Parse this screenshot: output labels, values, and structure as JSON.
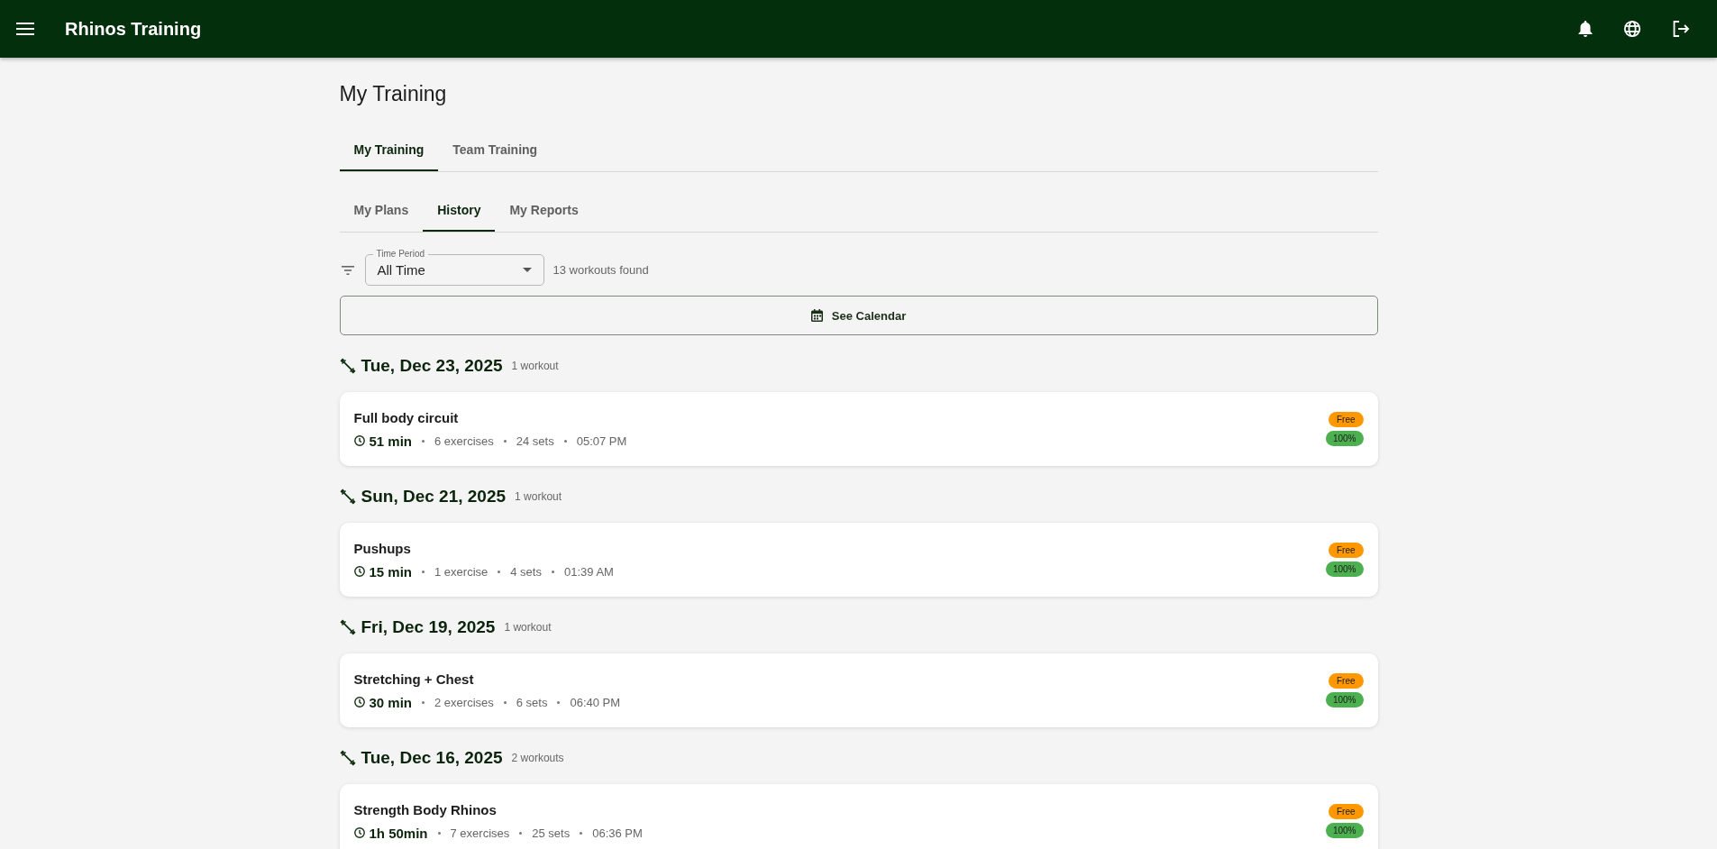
{
  "app_bar": {
    "title": "Rhinos Training"
  },
  "page_title": "My Training",
  "tabs": [
    {
      "label": "My Training",
      "selected": true
    },
    {
      "label": "Team Training",
      "selected": false
    }
  ],
  "sub_tabs": [
    {
      "label": "My Plans",
      "selected": false
    },
    {
      "label": "History",
      "selected": true
    },
    {
      "label": "My Reports",
      "selected": false
    }
  ],
  "filter": {
    "label": "Time Period",
    "value": "All Time",
    "result_count": "13 workouts found"
  },
  "calendar_button": "See Calendar",
  "days": [
    {
      "date": "Tue, Dec 23, 2025",
      "count": "1 workout",
      "workouts": [
        {
          "name": "Full body circuit",
          "duration": "51 min",
          "exercises": "6 exercises",
          "sets": "24 sets",
          "time": "05:07 PM",
          "badges": [
            {
              "kind": "type",
              "label": "Free"
            },
            {
              "kind": "completion",
              "label": "100%"
            }
          ]
        }
      ]
    },
    {
      "date": "Sun, Dec 21, 2025",
      "count": "1 workout",
      "workouts": [
        {
          "name": "Pushups",
          "duration": "15 min",
          "exercises": "1 exercise",
          "sets": "4 sets",
          "time": "01:39 AM",
          "badges": [
            {
              "kind": "type",
              "label": "Free"
            },
            {
              "kind": "completion",
              "label": "100%"
            }
          ]
        }
      ]
    },
    {
      "date": "Fri, Dec 19, 2025",
      "count": "1 workout",
      "workouts": [
        {
          "name": "Stretching + Chest",
          "duration": "30 min",
          "exercises": "2 exercises",
          "sets": "6 sets",
          "time": "06:40 PM",
          "badges": [
            {
              "kind": "type",
              "label": "Free"
            },
            {
              "kind": "completion",
              "label": "100%"
            }
          ]
        }
      ]
    },
    {
      "date": "Tue, Dec 16, 2025",
      "count": "2 workouts",
      "workouts": [
        {
          "name": "Strength Body Rhinos",
          "duration": "1h 50min",
          "exercises": "7 exercises",
          "sets": "25 sets",
          "time": "06:36 PM",
          "badges": [
            {
              "kind": "type",
              "label": "Free"
            },
            {
              "kind": "completion",
              "label": "100%"
            }
          ]
        }
      ]
    }
  ]
}
